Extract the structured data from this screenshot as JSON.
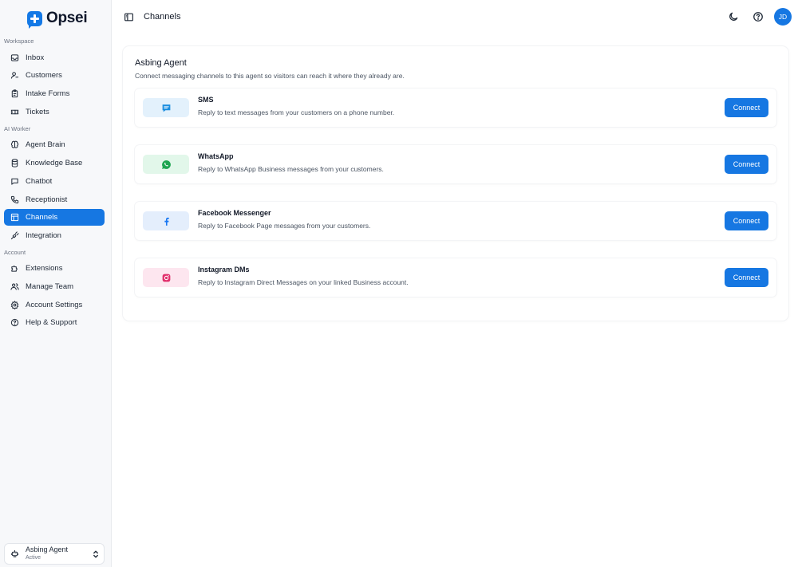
{
  "app": {
    "name": "Opsei"
  },
  "sidebar": {
    "sections": [
      {
        "label": "Workspace"
      },
      {
        "label": "AI Worker"
      },
      {
        "label": "Account"
      }
    ],
    "items": [
      {
        "label": "Inbox",
        "icon": "inbox-icon"
      },
      {
        "label": "Customers",
        "icon": "user-icon"
      },
      {
        "label": "Intake Forms",
        "icon": "clipboard-icon"
      },
      {
        "label": "Tickets",
        "icon": "ticket-icon"
      },
      {
        "label": "Agent Brain",
        "icon": "brain-icon"
      },
      {
        "label": "Knowledge Base",
        "icon": "database-icon"
      },
      {
        "label": "Chatbot",
        "icon": "chat-icon"
      },
      {
        "label": "Receptionist",
        "icon": "phone-icon"
      },
      {
        "label": "Channels",
        "icon": "channels-icon",
        "active": true
      },
      {
        "label": "Integration",
        "icon": "plug-icon"
      },
      {
        "label": "Extensions",
        "icon": "puzzle-icon"
      },
      {
        "label": "Manage Team",
        "icon": "users-icon"
      },
      {
        "label": "Account Settings",
        "icon": "settings-icon"
      },
      {
        "label": "Help & Support",
        "icon": "help-icon"
      }
    ],
    "agent": {
      "name": "Asbing Agent",
      "status": "Active"
    }
  },
  "header": {
    "title": "Channels",
    "avatar_initials": "JD"
  },
  "main": {
    "title": "Asbing Agent",
    "subtitle": "Connect messaging channels to this agent so visitors can reach it where they already are.",
    "channels": [
      {
        "name": "SMS",
        "description": "Reply to text messages from your customers on a phone number.",
        "button": "Connect",
        "icon": "sms-icon",
        "color": "#1d8fe0",
        "bg": "#e3f1fc"
      },
      {
        "name": "WhatsApp",
        "description": "Reply to WhatsApp Business messages from your customers.",
        "button": "Connect",
        "icon": "whatsapp-icon",
        "color": "#1ea551",
        "bg": "#e2f7ea"
      },
      {
        "name": "Facebook Messenger",
        "description": "Reply to Facebook Page messages from your customers.",
        "button": "Connect",
        "icon": "facebook-icon",
        "color": "#1877f2",
        "bg": "#e4eefc"
      },
      {
        "name": "Instagram DMs",
        "description": "Reply to Instagram Direct Messages on your linked Business account.",
        "button": "Connect",
        "icon": "instagram-icon",
        "color": "#e1306c",
        "bg": "#fde6ef"
      }
    ]
  },
  "colors": {
    "accent": "#1677e2"
  }
}
